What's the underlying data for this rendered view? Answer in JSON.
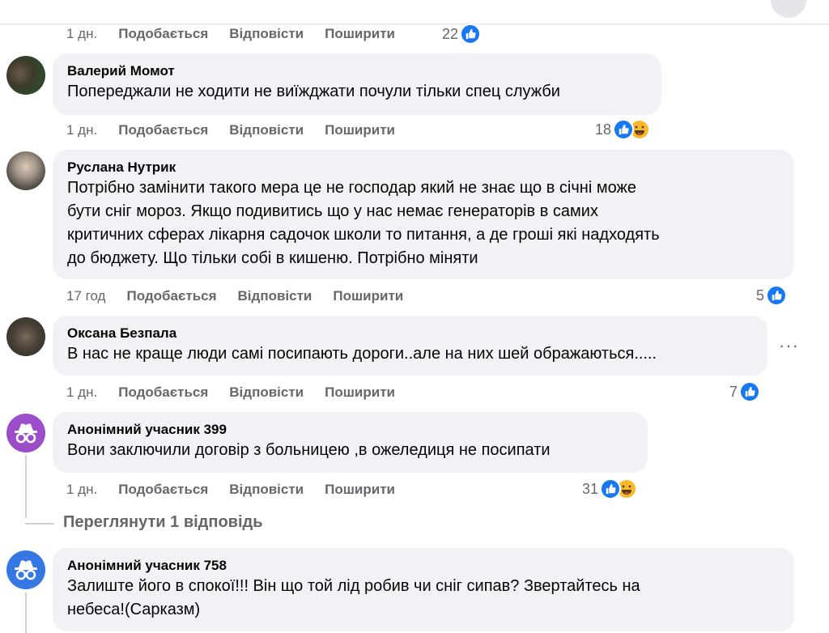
{
  "top_actions": {
    "time": "1 дн.",
    "like": "Подобається",
    "reply": "Відповісти",
    "share": "Поширити",
    "count": "22"
  },
  "comments": [
    {
      "author": "Валерий Момот",
      "text": "Попереджали не ходити не виїжджати почули тільки спец служби",
      "time": "1 дн.",
      "like": "Подобається",
      "reply": "Відповісти",
      "share": "Поширити",
      "count": "18"
    },
    {
      "author": "Руслана Нутрик",
      "text_lines": [
        "Потрібно замінити такого мера це не господар який не знає що в січні може",
        "бути сніг мороз. Якщо подивитись що у нас немає генераторів в самих",
        "критичних сферах лікарня садочок школи то питання, а де гроші які надходять",
        "до бюджету. Що тільки собі в кишеню. Потрібно міняти"
      ],
      "time": "17 год",
      "like": "Подобається",
      "reply": "Відповісти",
      "share": "Поширити",
      "count": "5"
    },
    {
      "author": "Оксана Безпала",
      "text": "В нас не краще люди самі посипають дороги..але на них шей ображаються.....",
      "time": "1 дн.",
      "like": "Подобається",
      "reply": "Відповісти",
      "share": "Поширити",
      "count": "7",
      "more": "···"
    },
    {
      "author": "Анонімний учасник 399",
      "text": "Вони заключили договір з больницею ,в ожеледиця не посипати",
      "time": "1 дн.",
      "like": "Подобається",
      "reply": "Відповісти",
      "share": "Поширити",
      "count": "31",
      "view_replies": "Переглянути 1 відповідь"
    },
    {
      "author": "Анонімний учасник 758",
      "text_lines": [
        "Залиште його в спокої!!! Він що той лід робив чи сніг сипав? Звертайтесь на",
        "небеса!(Сарказм)"
      ]
    }
  ],
  "colors": {
    "like_blue": "#1877f2",
    "haha_yellow": "#f7b928",
    "anon_purple": "#9b4dca",
    "anon_blue": "#3578e5",
    "bubble_bg": "#f0f2f5",
    "meta_gray": "#65676b"
  }
}
